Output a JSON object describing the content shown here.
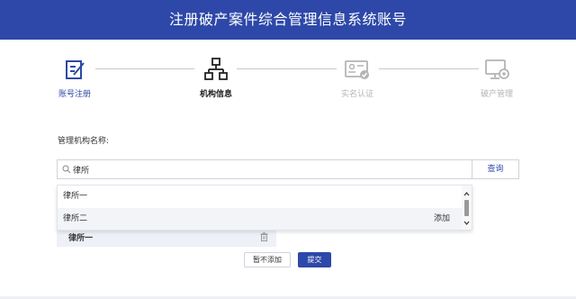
{
  "header": {
    "title": "注册破产案件综合管理信息系统账号"
  },
  "steps": [
    {
      "label": "账号注册",
      "icon": "edit-form-icon",
      "state": "done"
    },
    {
      "label": "机构信息",
      "icon": "org-chart-icon",
      "state": "current"
    },
    {
      "label": "实名认证",
      "icon": "id-card-verified-icon",
      "state": "pending"
    },
    {
      "label": "破产管理",
      "icon": "monitor-settings-icon",
      "state": "pending"
    }
  ],
  "form": {
    "field_label": "管理机构名称:",
    "search": {
      "value": "律所",
      "placeholder": ""
    },
    "search_button": "查询"
  },
  "dropdown": {
    "items": [
      {
        "name": "律所一",
        "action": ""
      },
      {
        "name": "律所二",
        "action": "添加"
      }
    ]
  },
  "selected": {
    "name": "律所一"
  },
  "buttons": {
    "skip": "暂不添加",
    "submit": "提交"
  },
  "colors": {
    "brand": "#2d48a8",
    "inactive": "#b4b4b4"
  }
}
